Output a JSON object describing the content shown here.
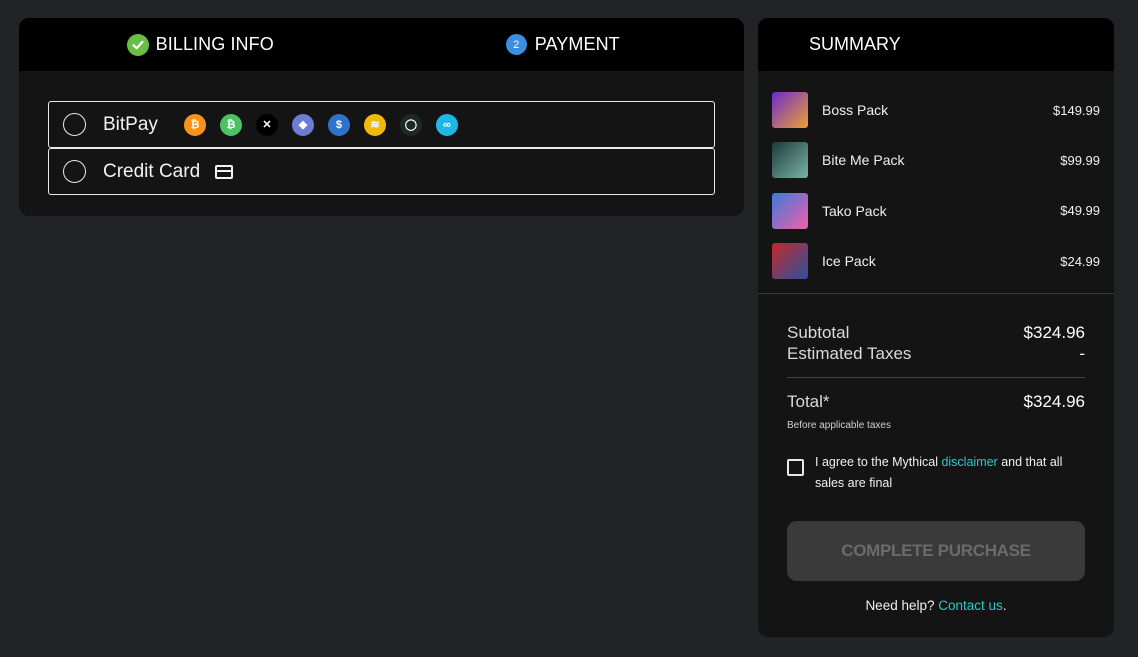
{
  "steps": [
    {
      "label": "BILLING INFO",
      "status": "complete",
      "icon": "check-icon"
    },
    {
      "label": "PAYMENT",
      "number": "2",
      "status": "current"
    }
  ],
  "payment_methods": [
    {
      "label": "BitPay",
      "selected": false,
      "coins": [
        {
          "icon": "bitcoin-icon",
          "glyph": "₿",
          "color": "#f7931a"
        },
        {
          "icon": "bitcoin-cash-icon",
          "glyph": "₿",
          "color": "#4cc265"
        },
        {
          "icon": "xrp-icon",
          "glyph": "✕",
          "color": "#000000"
        },
        {
          "icon": "ethereum-icon",
          "glyph": "◆",
          "color": "#6f7cd6"
        },
        {
          "icon": "usdc-icon",
          "glyph": "$",
          "color": "#2f72c9"
        },
        {
          "icon": "busd-icon",
          "glyph": "≋",
          "color": "#f0b90b"
        },
        {
          "icon": "ring-coin-icon",
          "glyph": "◯",
          "color": "#1d2a22"
        },
        {
          "icon": "chain-link-icon",
          "glyph": "∞",
          "color": "#1fb8e6"
        }
      ]
    },
    {
      "label": "Credit Card",
      "selected": false,
      "icon": "credit-card-icon"
    }
  ],
  "summary": {
    "title": "SUMMARY",
    "items": [
      {
        "name": "Boss Pack",
        "price": "$149.99",
        "colors": [
          "#6a2bd1",
          "#f0a030"
        ]
      },
      {
        "name": "Bite Me Pack",
        "price": "$99.99",
        "colors": [
          "#1e3a3a",
          "#7bb5a8"
        ]
      },
      {
        "name": "Tako Pack",
        "price": "$49.99",
        "colors": [
          "#3a7bdc",
          "#f25fa8"
        ]
      },
      {
        "name": "Ice Pack",
        "price": "$24.99",
        "colors": [
          "#c02a2a",
          "#2f4f9f"
        ]
      }
    ],
    "subtotal_label": "Subtotal",
    "subtotal_value": "$324.96",
    "taxes_label": "Estimated Taxes",
    "taxes_value": "-",
    "total_label": "Total*",
    "total_value": "$324.96",
    "total_note": "Before applicable taxes",
    "agree_prefix": "I agree to the Mythical ",
    "agree_link": "disclaimer",
    "agree_suffix": " and that all sales are final",
    "button_label": "COMPLETE PURCHASE",
    "help_prefix": "Need help? ",
    "help_link": "Contact us",
    "help_suffix": "."
  }
}
